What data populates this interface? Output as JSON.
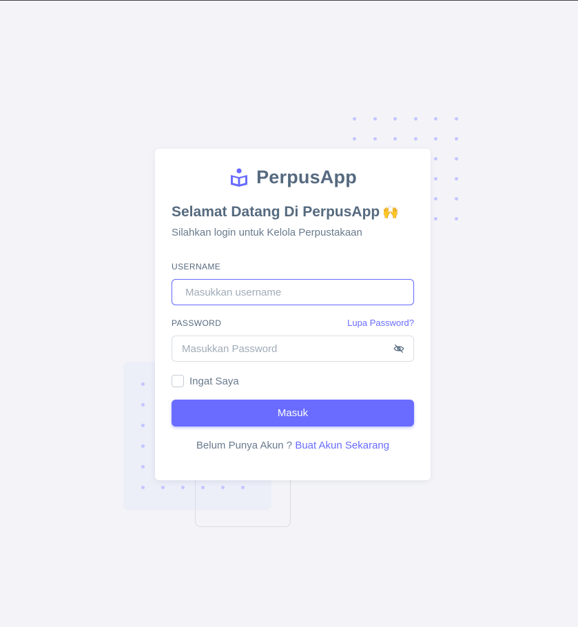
{
  "brand": {
    "name": "PerpusApp",
    "logo_icon": "book-reader-icon",
    "accent_color": "#696cff"
  },
  "welcome": {
    "title": "Selamat Datang Di PerpusApp",
    "emoji": "🙌",
    "subtitle": "Silahkan login untuk Kelola Perpustakaan"
  },
  "form": {
    "username_label": "USERNAME",
    "username_placeholder": "Masukkan username",
    "password_label": "PASSWORD",
    "forgot_link": "Lupa Password?",
    "password_placeholder": "Masukkan Password",
    "password_toggle_icon": "eye-off-icon",
    "remember_label": "Ingat Saya",
    "submit_label": "Masuk"
  },
  "signup": {
    "prompt": "Belum Punya Akun ?",
    "link": "Buat Akun Sekarang"
  }
}
